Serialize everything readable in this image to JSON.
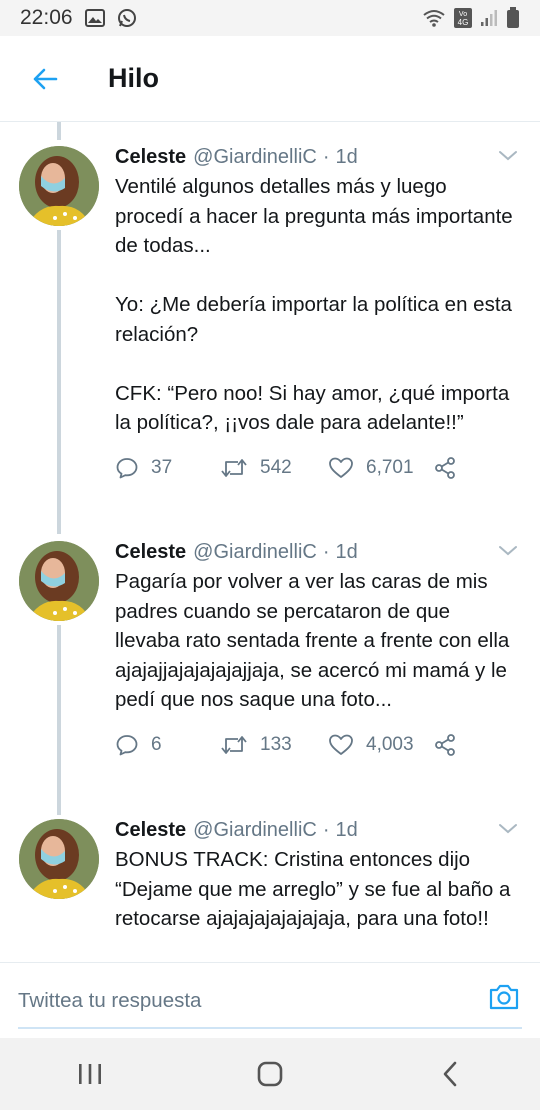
{
  "status_bar": {
    "time": "22:06",
    "icons": [
      "image-icon",
      "whatsapp-icon",
      "wifi-icon",
      "volte-4g-icon",
      "signal-icon",
      "battery-icon"
    ]
  },
  "header": {
    "title": "Hilo",
    "back_icon": "arrow-left-icon"
  },
  "tweets": [
    {
      "name": "Celeste",
      "handle": "@GiardinelliC",
      "dot": "·",
      "time": "1d",
      "text": "Ventilé algunos detalles más y luego procedí a hacer la pregunta más importante de todas...\n\nYo: ¿Me debería importar la política en esta relación?\n\nCFK: “Pero noo! Si hay amor, ¿qué importa la política?, ¡¡vos dale para adelante!!”",
      "replies": "37",
      "retweets": "542",
      "likes": "6,701"
    },
    {
      "name": "Celeste",
      "handle": "@GiardinelliC",
      "dot": "·",
      "time": "1d",
      "text": "Pagaría por volver a ver las caras de mis padres cuando se percataron de que llevaba rato sentada frente a frente con ella ajajajjajajajajajjaja, se acercó mi mamá y le pedí que nos saque una foto...",
      "replies": "6",
      "retweets": "133",
      "likes": "4,003"
    },
    {
      "name": "Celeste",
      "handle": "@GiardinelliC",
      "dot": "·",
      "time": "1d",
      "text": "BONUS TRACK: Cristina entonces dijo “Dejame que me arreglo” y se fue al baño a retocarse ajajajajajajajaja, para una foto!!"
    }
  ],
  "composer": {
    "placeholder": "Twittea tu respuesta"
  },
  "colors": {
    "accent": "#1da1f2",
    "text": "#14171a",
    "secondary": "#657786",
    "thread_line": "#ccd6dd"
  }
}
